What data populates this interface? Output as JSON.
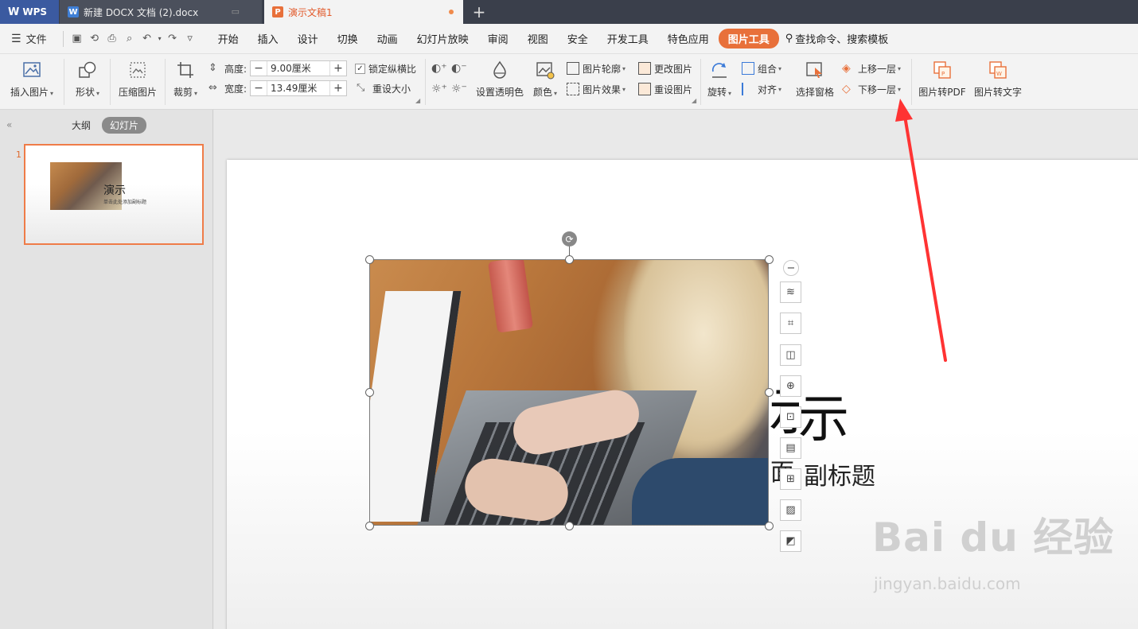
{
  "titlebar": {
    "wps_label": "WPS",
    "tabs": [
      {
        "label": "新建 DOCX 文档 (2).docx"
      },
      {
        "label": "演示文稿1"
      }
    ],
    "add_tab": "+"
  },
  "menubar": {
    "file_label": "文件",
    "items": [
      "开始",
      "插入",
      "设计",
      "切换",
      "动画",
      "幻灯片放映",
      "审阅",
      "视图",
      "安全",
      "开发工具",
      "特色应用",
      "图片工具"
    ],
    "active_item": "图片工具",
    "search_label": "查找命令、搜索模板"
  },
  "ribbon": {
    "insert_picture": "插入图片",
    "shape": "形状",
    "compress_picture": "压缩图片",
    "crop": "裁剪",
    "height_label": "高度:",
    "height_value": "9.00厘米",
    "width_label": "宽度:",
    "width_value": "13.49厘米",
    "lock_ratio": "锁定纵横比",
    "reset_size": "重设大小",
    "set_transparent": "设置透明色",
    "color": "颜色",
    "picture_outline": "图片轮廓",
    "picture_effect": "图片效果",
    "change_picture": "更改图片",
    "reset_picture": "重设图片",
    "rotate": "旋转",
    "group": "组合",
    "align": "对齐",
    "selection_pane": "选择窗格",
    "bring_forward": "上移一层",
    "send_backward": "下移一层",
    "to_pdf": "图片转PDF",
    "to_text": "图片转文字"
  },
  "leftpane": {
    "tab_outline": "大纲",
    "tab_slides": "幻灯片",
    "slide_number": "1",
    "thumb_title": "演示",
    "thumb_sub": "单击此处添加副标题"
  },
  "slide": {
    "title_fragment": "示",
    "subtitle_fragment": "副标题"
  },
  "watermark": {
    "main": "Bai du 经验",
    "url": "jingyan.baidu.com"
  },
  "colors": {
    "accent": "#e8703a",
    "arrow": "#ff3333",
    "titlebar": "#3a3f4b"
  }
}
